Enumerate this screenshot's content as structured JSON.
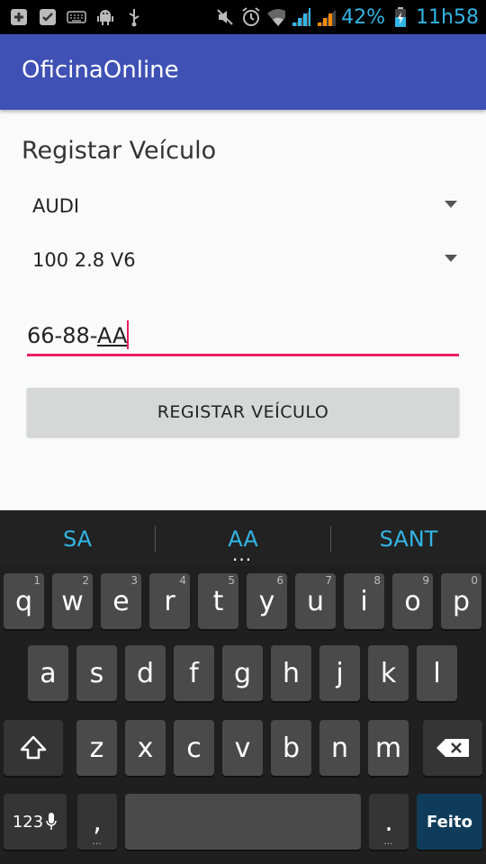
{
  "status_bar": {
    "icons": [
      "add-notification-icon",
      "check-notification-icon",
      "keyboard-icon",
      "android-debug-icon",
      "usb-icon",
      "mute-icon",
      "alarm-icon",
      "wifi-icon",
      "signal-icon",
      "signal-icon",
      "battery-icon"
    ],
    "battery_percent": "42%",
    "time": "11h58"
  },
  "app_bar": {
    "title": "OficinaOnline",
    "color": "#3f51b5"
  },
  "form": {
    "title": "Registar Veículo",
    "brand": {
      "value": "AUDI"
    },
    "model": {
      "value": "100 2.8 V6"
    },
    "plate": {
      "prefix": "66-88-",
      "composing": "AA"
    },
    "register_button": "REGISTAR VEÍCULO"
  },
  "keyboard": {
    "suggestions": [
      "SA",
      "AA",
      "SANT"
    ],
    "suggestion_more": "...",
    "row1": [
      {
        "label": "q",
        "hint": "1"
      },
      {
        "label": "w",
        "hint": "2"
      },
      {
        "label": "e",
        "hint": "3"
      },
      {
        "label": "r",
        "hint": "4"
      },
      {
        "label": "t",
        "hint": "5"
      },
      {
        "label": "y",
        "hint": "6"
      },
      {
        "label": "u",
        "hint": "7"
      },
      {
        "label": "i",
        "hint": "8"
      },
      {
        "label": "o",
        "hint": "9"
      },
      {
        "label": "p",
        "hint": "0"
      }
    ],
    "row2": [
      "a",
      "s",
      "d",
      "f",
      "g",
      "h",
      "j",
      "k",
      "l"
    ],
    "row3": [
      "z",
      "x",
      "c",
      "v",
      "b",
      "n",
      "m"
    ],
    "numbers_key": "123",
    "comma_key": ",",
    "period_key": ".",
    "done_key": "Feito",
    "accent_color": "#33b5e5"
  }
}
